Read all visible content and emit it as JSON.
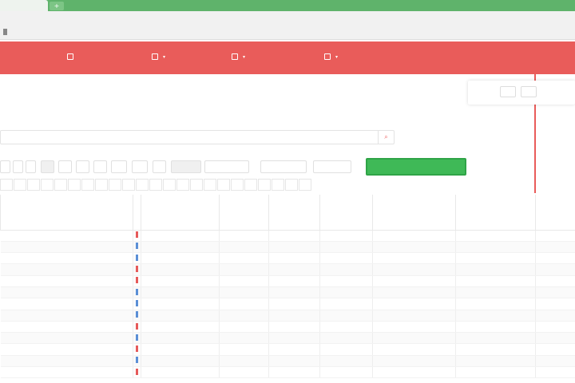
{
  "browser": {
    "tab_label": "",
    "url": ""
  },
  "navbar": {
    "brand": [
      "",
      ""
    ],
    "items": [
      {
        "label": "",
        "icon": "home-icon"
      },
      {
        "label": "",
        "icon": "users-icon"
      },
      {
        "label": "",
        "icon": "book-icon"
      },
      {
        "label": "",
        "icon": "settings-icon"
      }
    ]
  },
  "top_actions": {
    "label": "",
    "buttons": [
      "",
      ""
    ]
  },
  "page": {
    "title": "",
    "link": ""
  },
  "search": {
    "placeholder": ""
  },
  "toolbar": {
    "icon_buttons": [
      "",
      "",
      "",
      "",
      "",
      "",
      "",
      "",
      "",
      ""
    ],
    "text_buttons": [
      "",
      "",
      "",
      ""
    ]
  },
  "add_button": "",
  "letters": [
    "",
    "",
    "",
    "",
    "",
    "",
    "",
    "",
    "",
    "",
    "",
    "",
    "",
    "",
    "",
    "",
    "",
    "",
    "",
    "",
    "",
    "",
    ""
  ],
  "table": {
    "headers": [
      "",
      "",
      "",
      "",
      "",
      "",
      "",
      ""
    ],
    "rows": [
      {
        "name": "",
        "mark": "#e65a5a",
        "cells": [
          "",
          "",
          "",
          "",
          "",
          "",
          ""
        ]
      },
      {
        "name": "",
        "mark": "#5b8fd6",
        "cells": [
          "",
          "",
          "",
          "",
          "",
          "",
          ""
        ]
      },
      {
        "name": "",
        "mark": "#5b8fd6",
        "cells": [
          "",
          "",
          "",
          "",
          "",
          "",
          ""
        ]
      },
      {
        "name": "",
        "mark": "#e65a5a",
        "cells": [
          "",
          "",
          "",
          "",
          "",
          "",
          ""
        ]
      },
      {
        "name": "",
        "mark": "#e65a5a",
        "cells": [
          "",
          "",
          "",
          "",
          "",
          "",
          ""
        ]
      },
      {
        "name": "",
        "mark": "#5b8fd6",
        "cells": [
          "",
          "",
          "",
          "",
          "",
          "",
          ""
        ]
      },
      {
        "name": "",
        "mark": "#5b8fd6",
        "cells": [
          "",
          "",
          "",
          "",
          "",
          "",
          ""
        ]
      },
      {
        "name": "",
        "mark": "#5b8fd6",
        "cells": [
          "",
          "",
          "",
          "",
          "",
          "",
          ""
        ]
      },
      {
        "name": "",
        "mark": "#e65a5a",
        "cells": [
          "",
          "",
          "",
          "",
          "",
          "",
          ""
        ]
      },
      {
        "name": "",
        "mark": "#5b8fd6",
        "cells": [
          "",
          "",
          "",
          "",
          "",
          "",
          ""
        ]
      },
      {
        "name": "",
        "mark": "#e65a5a",
        "cells": [
          "",
          "",
          "",
          "",
          "",
          "",
          ""
        ]
      },
      {
        "name": "",
        "mark": "#5b8fd6",
        "cells": [
          "",
          "",
          "",
          "",
          "",
          "",
          ""
        ]
      },
      {
        "name": "",
        "mark": "#e65a5a",
        "cells": [
          "",
          "",
          "",
          "",
          "",
          "",
          ""
        ]
      }
    ]
  },
  "colors": {
    "accent": "#e95c5a",
    "success": "#3fb957",
    "browser_bar": "#5fb36b"
  }
}
